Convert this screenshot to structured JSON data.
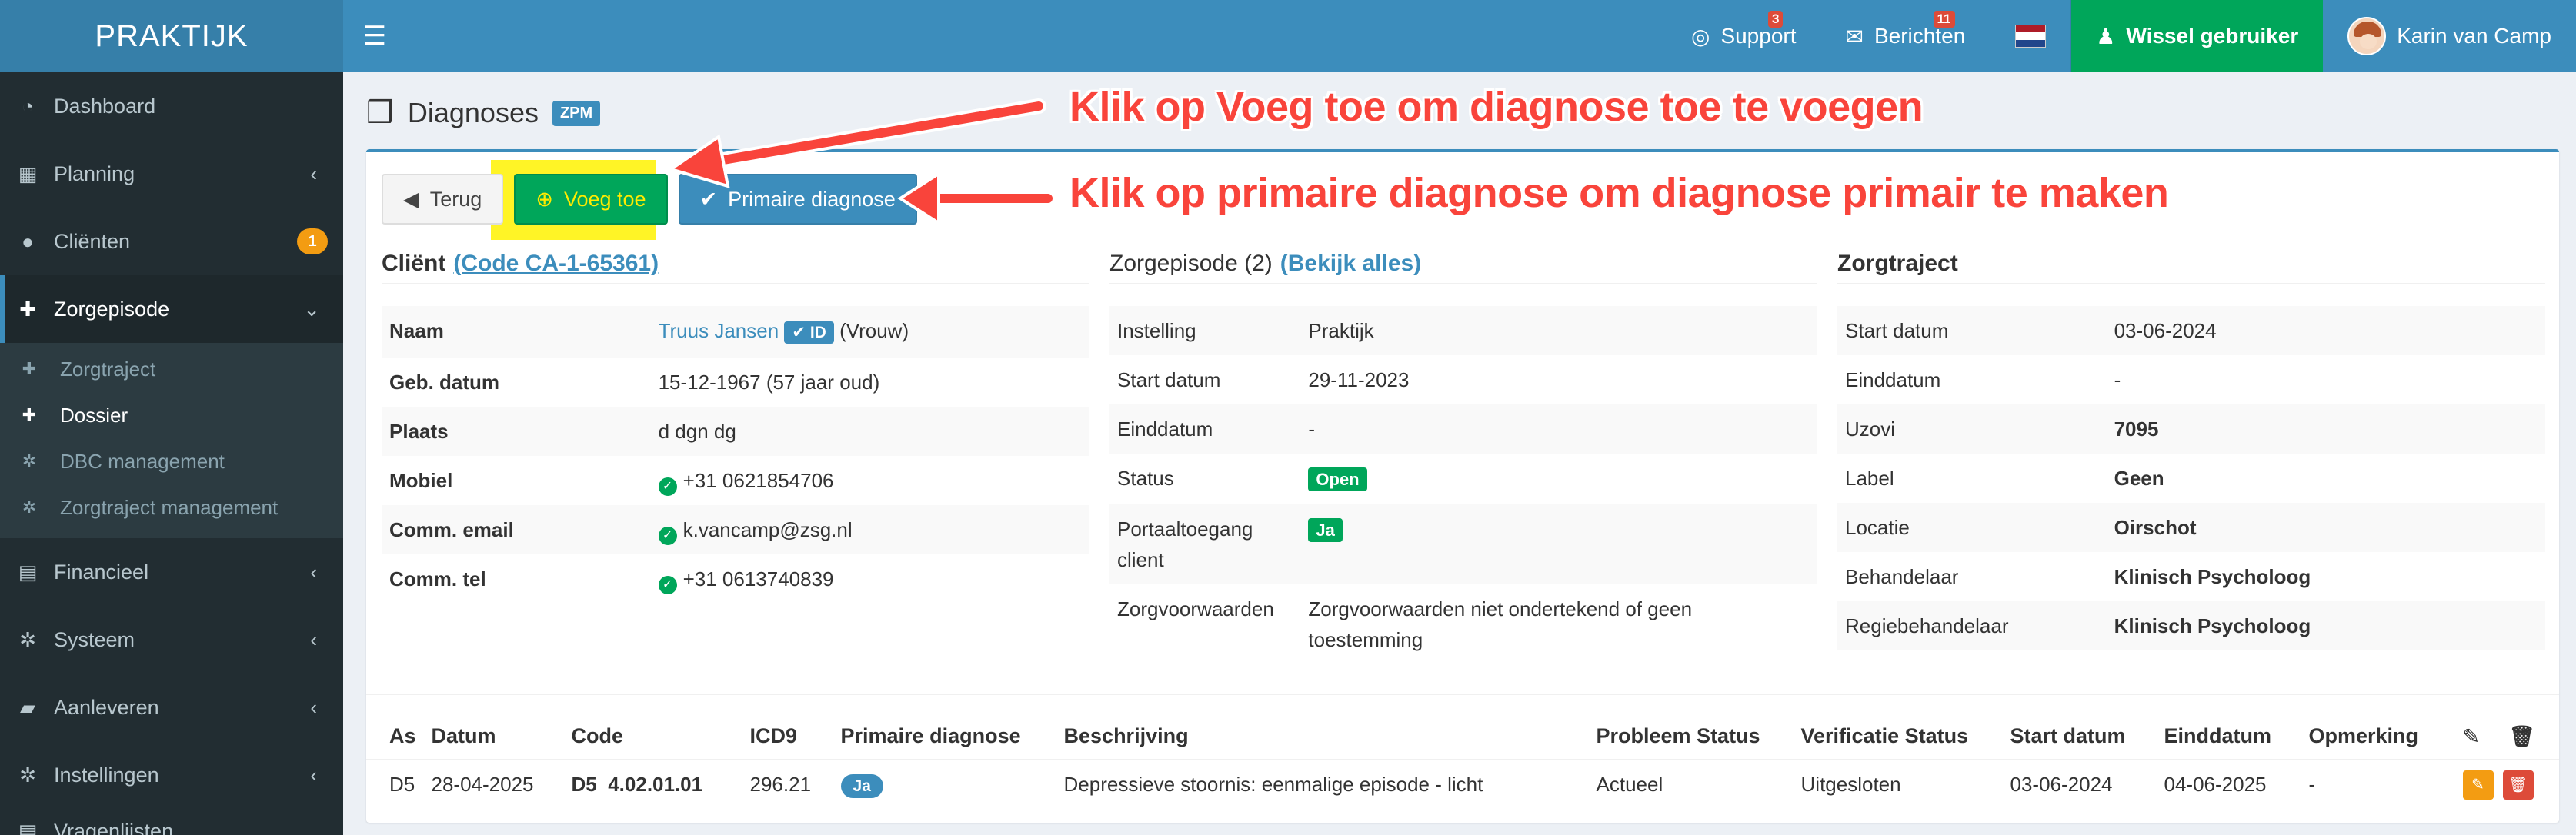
{
  "app": {
    "brand": "PRAKTIJK"
  },
  "topnav": {
    "support_label": "Support",
    "support_badge": "3",
    "messages_label": "Berichten",
    "messages_badge": "11",
    "switch_label": "Wissel gebruiker",
    "user_name": "Karin van Camp"
  },
  "sidebar": {
    "dashboard": "Dashboard",
    "planning": "Planning",
    "clients": "Cliënten",
    "clients_badge": "1",
    "zorgepisode": "Zorgepisode",
    "sub": {
      "zorgtraject": "Zorgtraject",
      "dossier": "Dossier",
      "dbc": "DBC management",
      "zt_management": "Zorgtraject management"
    },
    "financieel": "Financieel",
    "systeem": "Systeem",
    "aanleveren": "Aanleveren",
    "instellingen": "Instellingen",
    "vragenlijsten": "Vragenlijsten"
  },
  "page": {
    "title": "Diagnoses",
    "tag": "ZPM"
  },
  "buttons": {
    "back": "Terug",
    "add": "Voeg toe",
    "primary": "Primaire diagnose"
  },
  "client": {
    "title": "Cliënt",
    "code": "(Code CA-1-65361)",
    "rows": {
      "naam_k": "Naam",
      "naam_v": "Truus Jansen",
      "id_badge": "ID",
      "gender": "(Vrouw)",
      "geb_k": "Geb. datum",
      "geb_v": "15-12-1967 (57 jaar oud)",
      "plaats_k": "Plaats",
      "plaats_v": "d dgn dg",
      "mobiel_k": "Mobiel",
      "mobiel_v": "+31 0621854706",
      "email_k": "Comm. email",
      "email_v": "k.vancamp@zsg.nl",
      "tel_k": "Comm. tel",
      "tel_v": "+31 0613740839"
    }
  },
  "episode": {
    "title": "Zorgepisode (2)",
    "link": "(Bekijk alles)",
    "rows": {
      "instelling_k": "Instelling",
      "instelling_v": "Praktijk",
      "start_k": "Start datum",
      "start_v": "29-11-2023",
      "eind_k": "Einddatum",
      "eind_v": "-",
      "status_k": "Status",
      "status_v": "Open",
      "portaal_k": "Portaaltoegang client",
      "portaal_v": "Ja",
      "zv_k": "Zorgvoorwaarden",
      "zv_v": "Zorgvoorwaarden niet ondertekend of geen toestemming"
    }
  },
  "traject": {
    "title": "Zorgtraject",
    "rows": {
      "start_k": "Start datum",
      "start_v": "03-06-2024",
      "eind_k": "Einddatum",
      "eind_v": "-",
      "uzovi_k": "Uzovi",
      "uzovi_v": "7095",
      "label_k": "Label",
      "label_v": "Geen",
      "locatie_k": "Locatie",
      "locatie_v": "Oirschot",
      "beh_k": "Behandelaar",
      "beh_v": "Klinisch Psycholoog",
      "regie_k": "Regiebehandelaar",
      "regie_v": "Klinisch Psycholoog"
    }
  },
  "diagnoses": {
    "headers": [
      "As",
      "Datum",
      "Code",
      "ICD9",
      "Primaire diagnose",
      "Beschrijving",
      "Probleem Status",
      "Verificatie Status",
      "Start datum",
      "Einddatum",
      "Opmerking"
    ],
    "row": {
      "as": "D5",
      "datum": "28-04-2025",
      "code": "D5_4.02.01.01",
      "icd9": "296.21",
      "primair": "Ja",
      "beschrijving": "Depressieve stoornis: eenmalige episode - licht",
      "probleem": "Actueel",
      "verificatie": "Uitgesloten",
      "start": "03-06-2024",
      "eind": "04-06-2025",
      "opmerking": "-"
    }
  },
  "annotations": {
    "add": "Klik op Voeg toe om diagnose toe te voegen",
    "primary": "Klik op primaire diagnose om diagnose primair te maken"
  }
}
